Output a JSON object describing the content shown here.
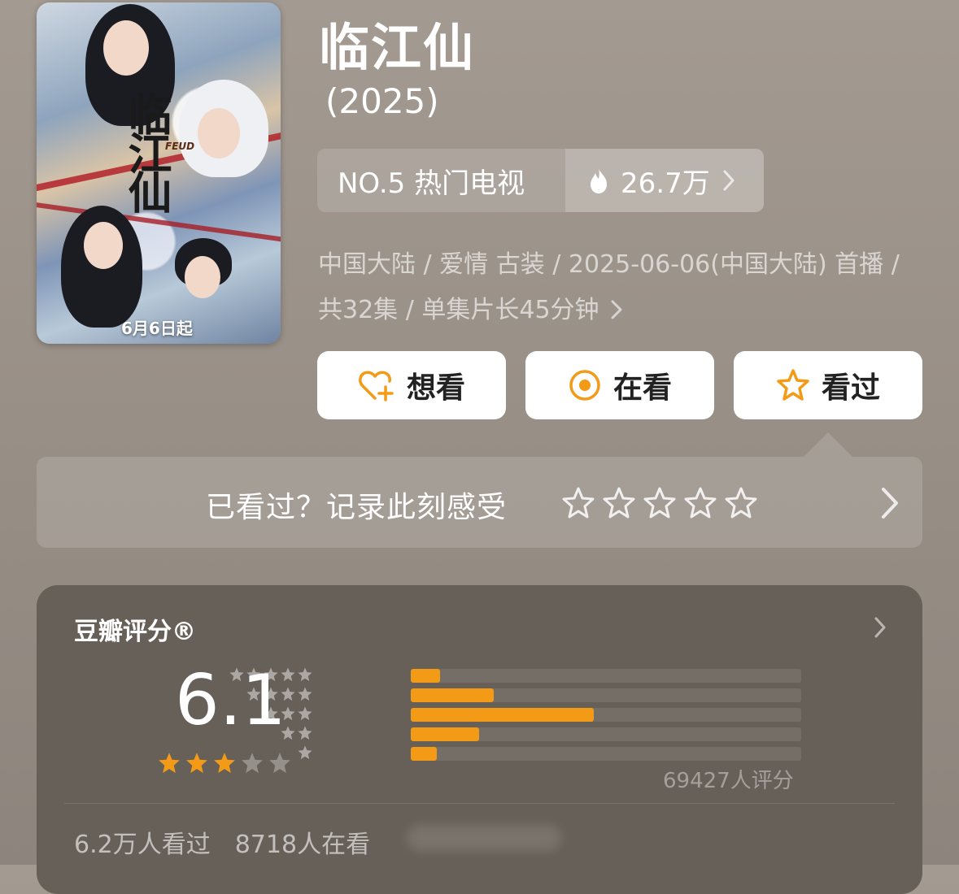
{
  "poster": {
    "title_calligraphy": "临江仙",
    "subtitle_en": "FEUD",
    "release_caption": "6月6日起"
  },
  "title": "临江仙",
  "year": "(2025)",
  "rank": {
    "label": "NO.5 热门电视",
    "heat": "26.7万",
    "flame_icon": "flame-icon"
  },
  "meta": {
    "text": "中国大陆 / 爱情 古装 / 2025-06-06(中国大陆) 首播 / 共32集 / 单集片长45分钟"
  },
  "actions": {
    "want": "想看",
    "watching": "在看",
    "watched": "看过"
  },
  "record": {
    "prompt": "已看过？记录此刻感受",
    "stars": 5
  },
  "rating": {
    "label": "豆瓣评分®",
    "score": "6.1",
    "stars_filled": 3,
    "stars_total": 5,
    "distribution": [
      {
        "stars": 5,
        "fraction": 0.075
      },
      {
        "stars": 4,
        "fraction": 0.213
      },
      {
        "stars": 3,
        "fraction": 0.469
      },
      {
        "stars": 2,
        "fraction": 0.175
      },
      {
        "stars": 1,
        "fraction": 0.067
      }
    ],
    "count": "69427人评分",
    "watched": "6.2万人看过",
    "watching": "8718人在看"
  },
  "colors": {
    "accent": "#f39a17",
    "button_bg": "#ffffff",
    "card_bg": "#676058"
  }
}
